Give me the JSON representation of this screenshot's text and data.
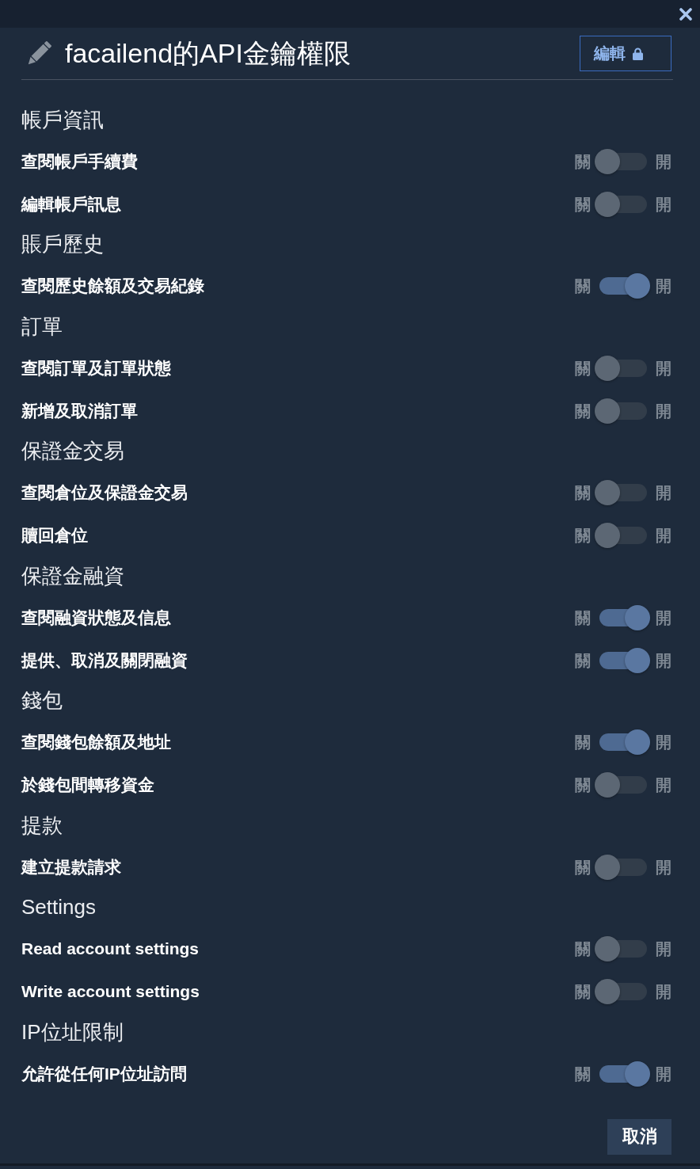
{
  "header": {
    "title": "facailend的API金鑰權限",
    "edit_button": "編輯"
  },
  "sections": [
    {
      "title": "帳戶資訊",
      "permissions": [
        {
          "label": "查閱帳戶手續費",
          "off_label": "關",
          "on_label": "開",
          "on": false
        },
        {
          "label": "編輯帳戶訊息",
          "off_label": "關",
          "on_label": "開",
          "on": false
        }
      ]
    },
    {
      "title": "賬戶歷史",
      "permissions": [
        {
          "label": "查閱歷史餘額及交易紀錄",
          "off_label": "關",
          "on_label": "開",
          "on": true
        }
      ]
    },
    {
      "title": "訂單",
      "permissions": [
        {
          "label": "查閱訂單及訂單狀態",
          "off_label": "關",
          "on_label": "開",
          "on": false
        },
        {
          "label": "新增及取消訂單",
          "off_label": "關",
          "on_label": "開",
          "on": false
        }
      ]
    },
    {
      "title": "保證金交易",
      "permissions": [
        {
          "label": "查閱倉位及保證金交易",
          "off_label": "關",
          "on_label": "開",
          "on": false
        },
        {
          "label": "贖回倉位",
          "off_label": "關",
          "on_label": "開",
          "on": false
        }
      ]
    },
    {
      "title": "保證金融資",
      "permissions": [
        {
          "label": "查閱融資狀態及信息",
          "off_label": "關",
          "on_label": "開",
          "on": true
        },
        {
          "label": "提供、取消及關閉融資",
          "off_label": "關",
          "on_label": "開",
          "on": true
        }
      ]
    },
    {
      "title": "錢包",
      "permissions": [
        {
          "label": "查閱錢包餘額及地址",
          "off_label": "關",
          "on_label": "開",
          "on": true
        },
        {
          "label": "於錢包間轉移資金",
          "off_label": "關",
          "on_label": "開",
          "on": false
        }
      ]
    },
    {
      "title": "提款",
      "permissions": [
        {
          "label": "建立提款請求",
          "off_label": "關",
          "on_label": "開",
          "on": false
        }
      ]
    },
    {
      "title": "Settings",
      "permissions": [
        {
          "label": "Read account settings",
          "off_label": "關",
          "on_label": "開",
          "on": false
        },
        {
          "label": "Write account settings",
          "off_label": "關",
          "on_label": "開",
          "on": false
        }
      ]
    },
    {
      "title": "IP位址限制",
      "permissions": [
        {
          "label": "允許從任何IP位址訪問",
          "off_label": "關",
          "on_label": "開",
          "on": true
        }
      ]
    }
  ],
  "footer": {
    "cancel_button": "取消"
  }
}
